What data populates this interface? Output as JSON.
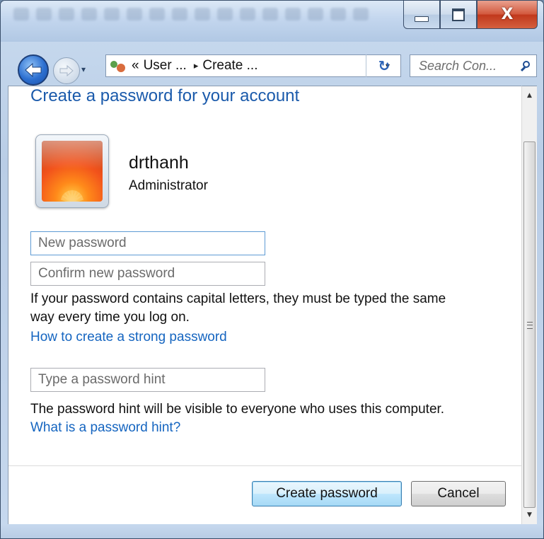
{
  "window": {
    "title_buttons": {
      "minimize_icon": "minimize-icon",
      "maximize_icon": "maximize-icon",
      "close_glyph": "X"
    }
  },
  "navigation": {
    "back_icon": "back-arrow-icon",
    "forward_icon": "forward-arrow-icon",
    "dropdown_glyph": "▾",
    "address": {
      "prefix": "«",
      "crumbs": [
        "User ...",
        "Create ..."
      ],
      "separator": "▸",
      "dropdown_glyph": "▾"
    },
    "refresh_glyph": "↻",
    "search": {
      "placeholder": "Search Con..."
    }
  },
  "page": {
    "heading": "Create a password for your account",
    "user": {
      "name": "drthanh",
      "role": "Administrator"
    },
    "fields": {
      "new_password_placeholder": "New password",
      "confirm_password_placeholder": "Confirm new password",
      "hint_placeholder": "Type a password hint"
    },
    "capital_note_line1": "If your password contains capital letters, they must be typed the same",
    "capital_note_line2": "way every time you log on.",
    "strong_password_link": "How to create a strong password",
    "hint_note": "The password hint will be visible to everyone who uses this computer.",
    "hint_link": "What is a password hint?",
    "buttons": {
      "create": "Create password",
      "cancel": "Cancel"
    }
  },
  "scrollbar": {
    "up_glyph": "▲",
    "down_glyph": "▼"
  },
  "colors": {
    "link": "#1565c0",
    "heading": "#1a5aab",
    "close_button": "#c1381c"
  }
}
